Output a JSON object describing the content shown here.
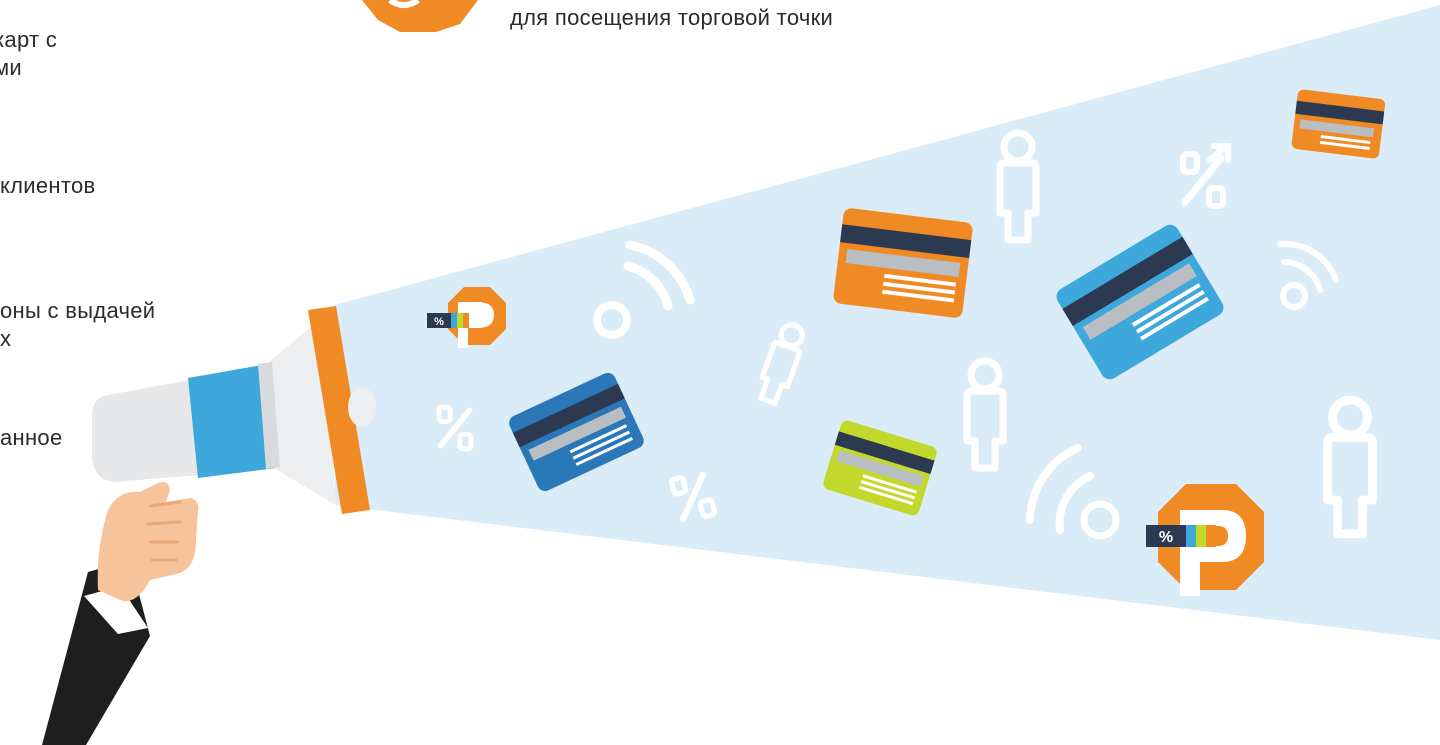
{
  "left_text": {
    "item1_line1": "карт с",
    "item1_line2": "ми",
    "item2": "клиентов",
    "item3_line1": "оны с выдачей",
    "item3_line2": "х",
    "item4": "анное"
  },
  "top_caption": "для посещения торговой точки",
  "badge": {
    "percent_symbol": "%"
  },
  "colors": {
    "beam": "#dbecf9",
    "orange": "#f08a24",
    "blue": "#3ea7dc",
    "dark_blue": "#2a78b8",
    "navy": "#2b3a50",
    "lime": "#c3d82c",
    "gray_stripe": "#b9bec3",
    "suit": "#1e1e1e",
    "skin": "#f7c39a"
  }
}
